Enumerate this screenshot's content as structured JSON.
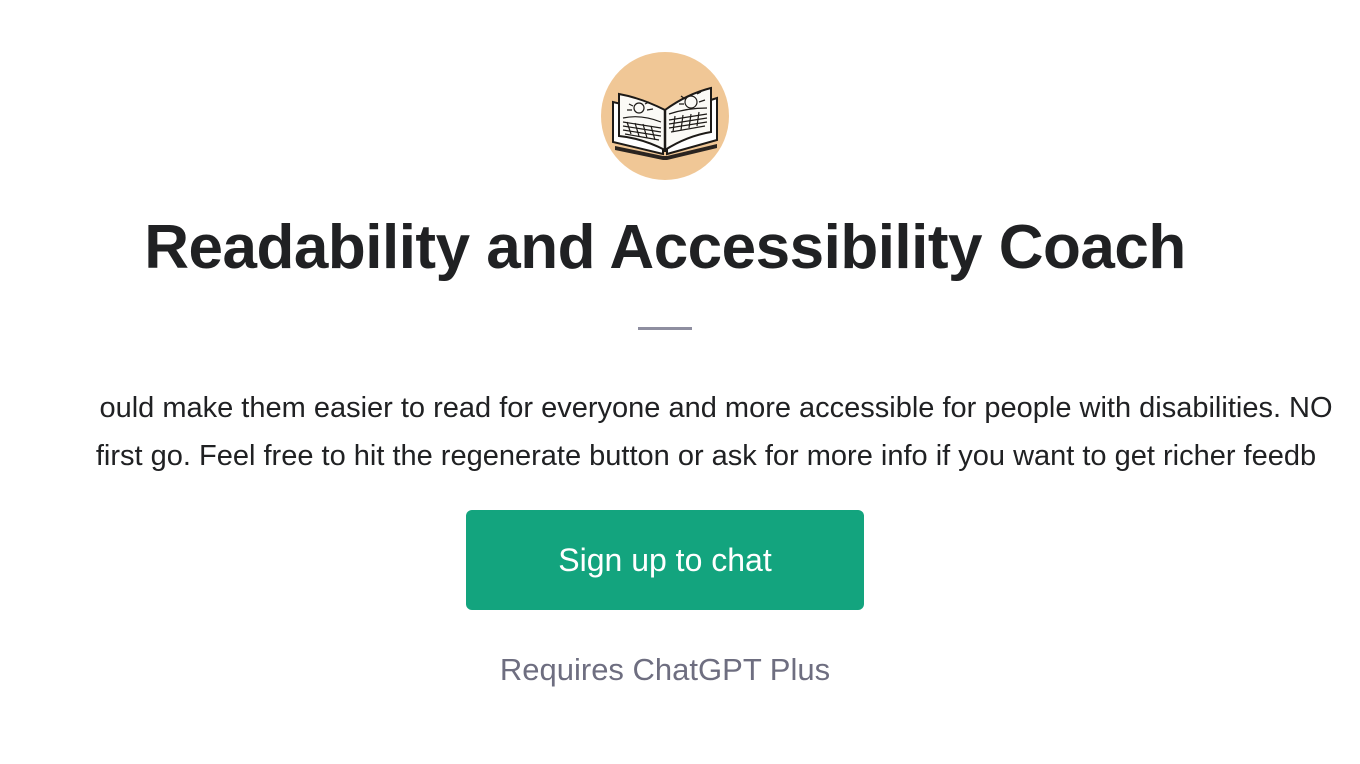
{
  "gpt": {
    "avatar_icon": "open-book-icon",
    "avatar_bg": "#f0c796",
    "title": "Readability and Accessibility Coach",
    "description_line_1": "ould make them easier to read for everyone and more accessible for people with disabilities. NO",
    "description_line_2": "first go. Feel free to hit the regenerate button or ask for more info if you want to get richer feedb"
  },
  "actions": {
    "signup_label": "Sign up to chat",
    "signup_color": "#13a47e",
    "requires_label": "Requires ChatGPT Plus"
  }
}
